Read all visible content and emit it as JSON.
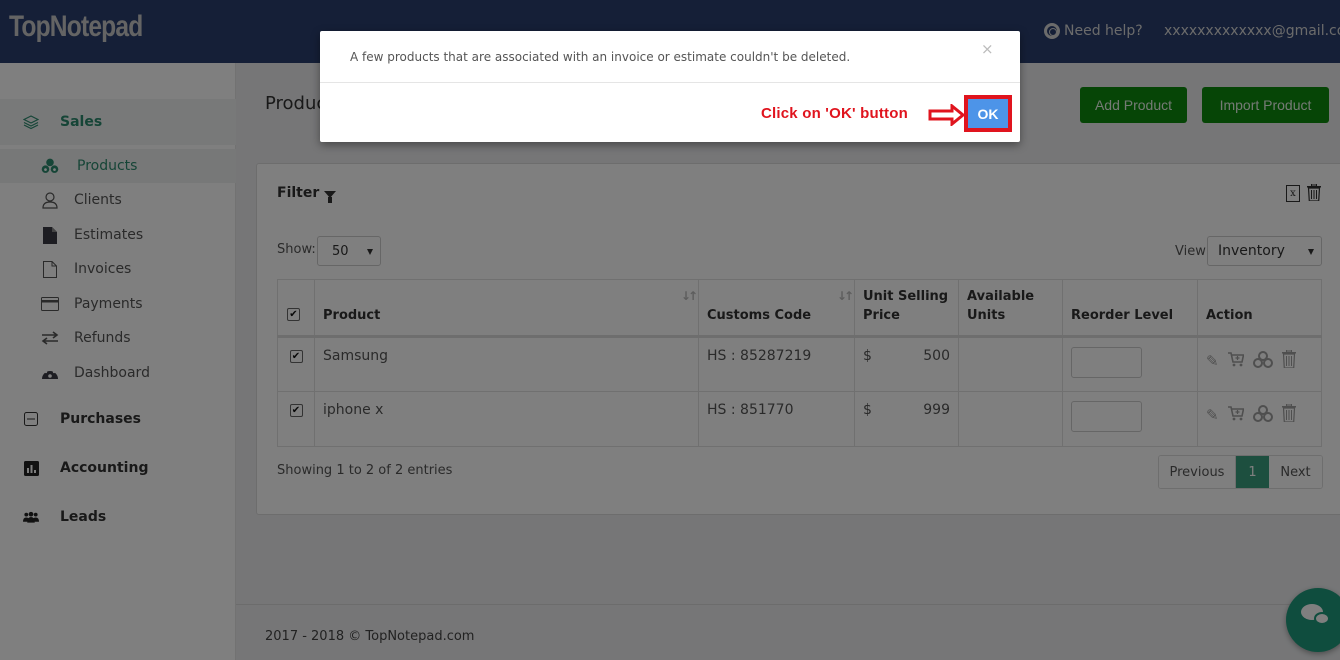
{
  "header": {
    "logo": "TopNotepad",
    "help_label": "Need help?",
    "user_email": "xxxxxxxxxxxxx@gmail.com"
  },
  "sidebar": {
    "groups": [
      {
        "label": "Sales",
        "icon": "layers-icon",
        "active": true
      },
      {
        "label": "Purchases",
        "icon": "minus-square-icon"
      },
      {
        "label": "Accounting",
        "icon": "bar-chart-icon"
      },
      {
        "label": "Leads",
        "icon": "users-icon"
      }
    ],
    "sales_items": [
      {
        "label": "Products",
        "icon": "cubes-icon",
        "active": true
      },
      {
        "label": "Clients",
        "icon": "user-icon"
      },
      {
        "label": "Estimates",
        "icon": "file-filled-icon"
      },
      {
        "label": "Invoices",
        "icon": "file-outline-icon"
      },
      {
        "label": "Payments",
        "icon": "credit-card-icon"
      },
      {
        "label": "Refunds",
        "icon": "exchange-icon"
      },
      {
        "label": "Dashboard",
        "icon": "dashboard-icon"
      }
    ]
  },
  "main": {
    "page_title": "Products",
    "add_product_label": "Add Product",
    "import_product_label": "Import Product",
    "filter_label": "Filter",
    "show_label": "Show:",
    "show_value": "50",
    "view_label": "View",
    "view_value": "Inventory",
    "table": {
      "columns": [
        "Product",
        "Customs Code",
        "Unit Selling Price",
        "Available Units",
        "Reorder Level",
        "Action"
      ],
      "rows": [
        {
          "checked": true,
          "product": "Samsung",
          "customs_code": "HS : 85287219",
          "currency": "$",
          "price": "500",
          "available_units": "",
          "reorder_level": ""
        },
        {
          "checked": true,
          "product": "iphone x",
          "customs_code": "HS : 851770",
          "currency": "$",
          "price": "999",
          "available_units": "",
          "reorder_level": ""
        }
      ]
    },
    "showing_text": "Showing 1 to 2 of 2 entries",
    "pagination": {
      "previous": "Previous",
      "current": "1",
      "next": "Next"
    },
    "footer": "2017 - 2018 © TopNotepad.com"
  },
  "modal": {
    "message": "A few products that are associated with an invoice or estimate couldn't be deleted.",
    "close": "×",
    "ok_label": "OK",
    "annotation": "Click on 'OK' button"
  },
  "colors": {
    "header_bg": "#2a3f6e",
    "accent_green": "#2d8a6e",
    "button_green": "#0d8a0d",
    "ok_blue": "#4d94e8",
    "annotation_red": "#e0141e"
  }
}
